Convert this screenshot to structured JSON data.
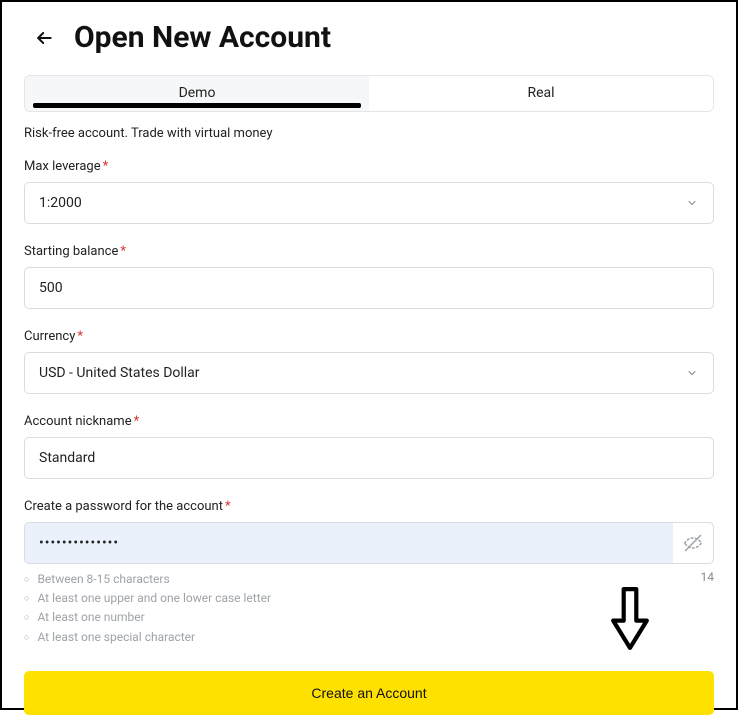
{
  "header": {
    "title": "Open New Account"
  },
  "tabs": {
    "demo": "Demo",
    "real": "Real"
  },
  "subtitle": "Risk-free account. Trade with virtual money",
  "fields": {
    "leverage": {
      "label": "Max leverage",
      "value": "1:2000"
    },
    "balance": {
      "label": "Starting balance",
      "value": "500"
    },
    "currency": {
      "label": "Currency",
      "value": "USD - United States Dollar"
    },
    "nickname": {
      "label": "Account nickname",
      "value": "Standard"
    },
    "password": {
      "label": "Create a password for the account",
      "value": "••••••••••••••",
      "count": "14",
      "hints": {
        "h1": "Between 8-15 characters",
        "h2": "At least one upper and one lower case letter",
        "h3": "At least one number",
        "h4": "At least one special character"
      }
    }
  },
  "cta": "Create an Account"
}
